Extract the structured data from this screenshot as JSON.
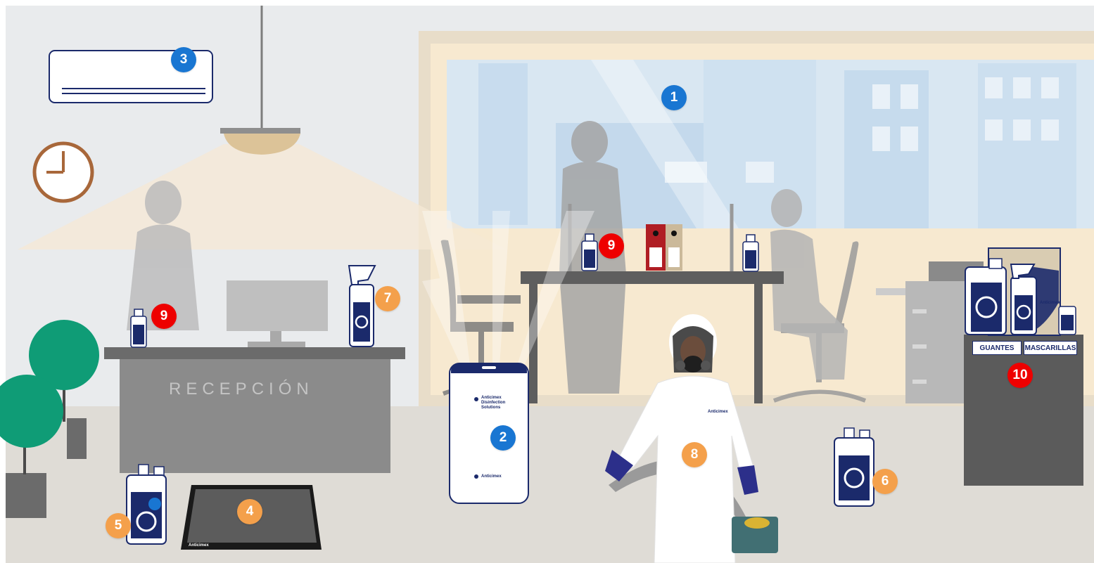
{
  "scene": {
    "reception_sign": "RECEPCIÓN",
    "shelf_labels": [
      "GUANTES",
      "MASCARILLAS"
    ],
    "brand": "Anticimex",
    "purifier_brand_lines": [
      "Anticimex",
      "Disinfection",
      "Solutions"
    ]
  },
  "markers": [
    {
      "label": "1",
      "color": "blue"
    },
    {
      "label": "2",
      "color": "blue"
    },
    {
      "label": "3",
      "color": "blue"
    },
    {
      "label": "4",
      "color": "orange"
    },
    {
      "label": "5",
      "color": "orange"
    },
    {
      "label": "6",
      "color": "orange"
    },
    {
      "label": "7",
      "color": "orange"
    },
    {
      "label": "8",
      "color": "orange"
    },
    {
      "label": "9",
      "color": "red"
    },
    {
      "label": "9",
      "color": "red"
    },
    {
      "label": "10",
      "color": "red"
    }
  ],
  "colors": {
    "blue_marker": "#1976d2",
    "orange_marker": "#f4a04b",
    "red_marker": "#ee0000",
    "brand_navy": "#1b2a6b"
  }
}
